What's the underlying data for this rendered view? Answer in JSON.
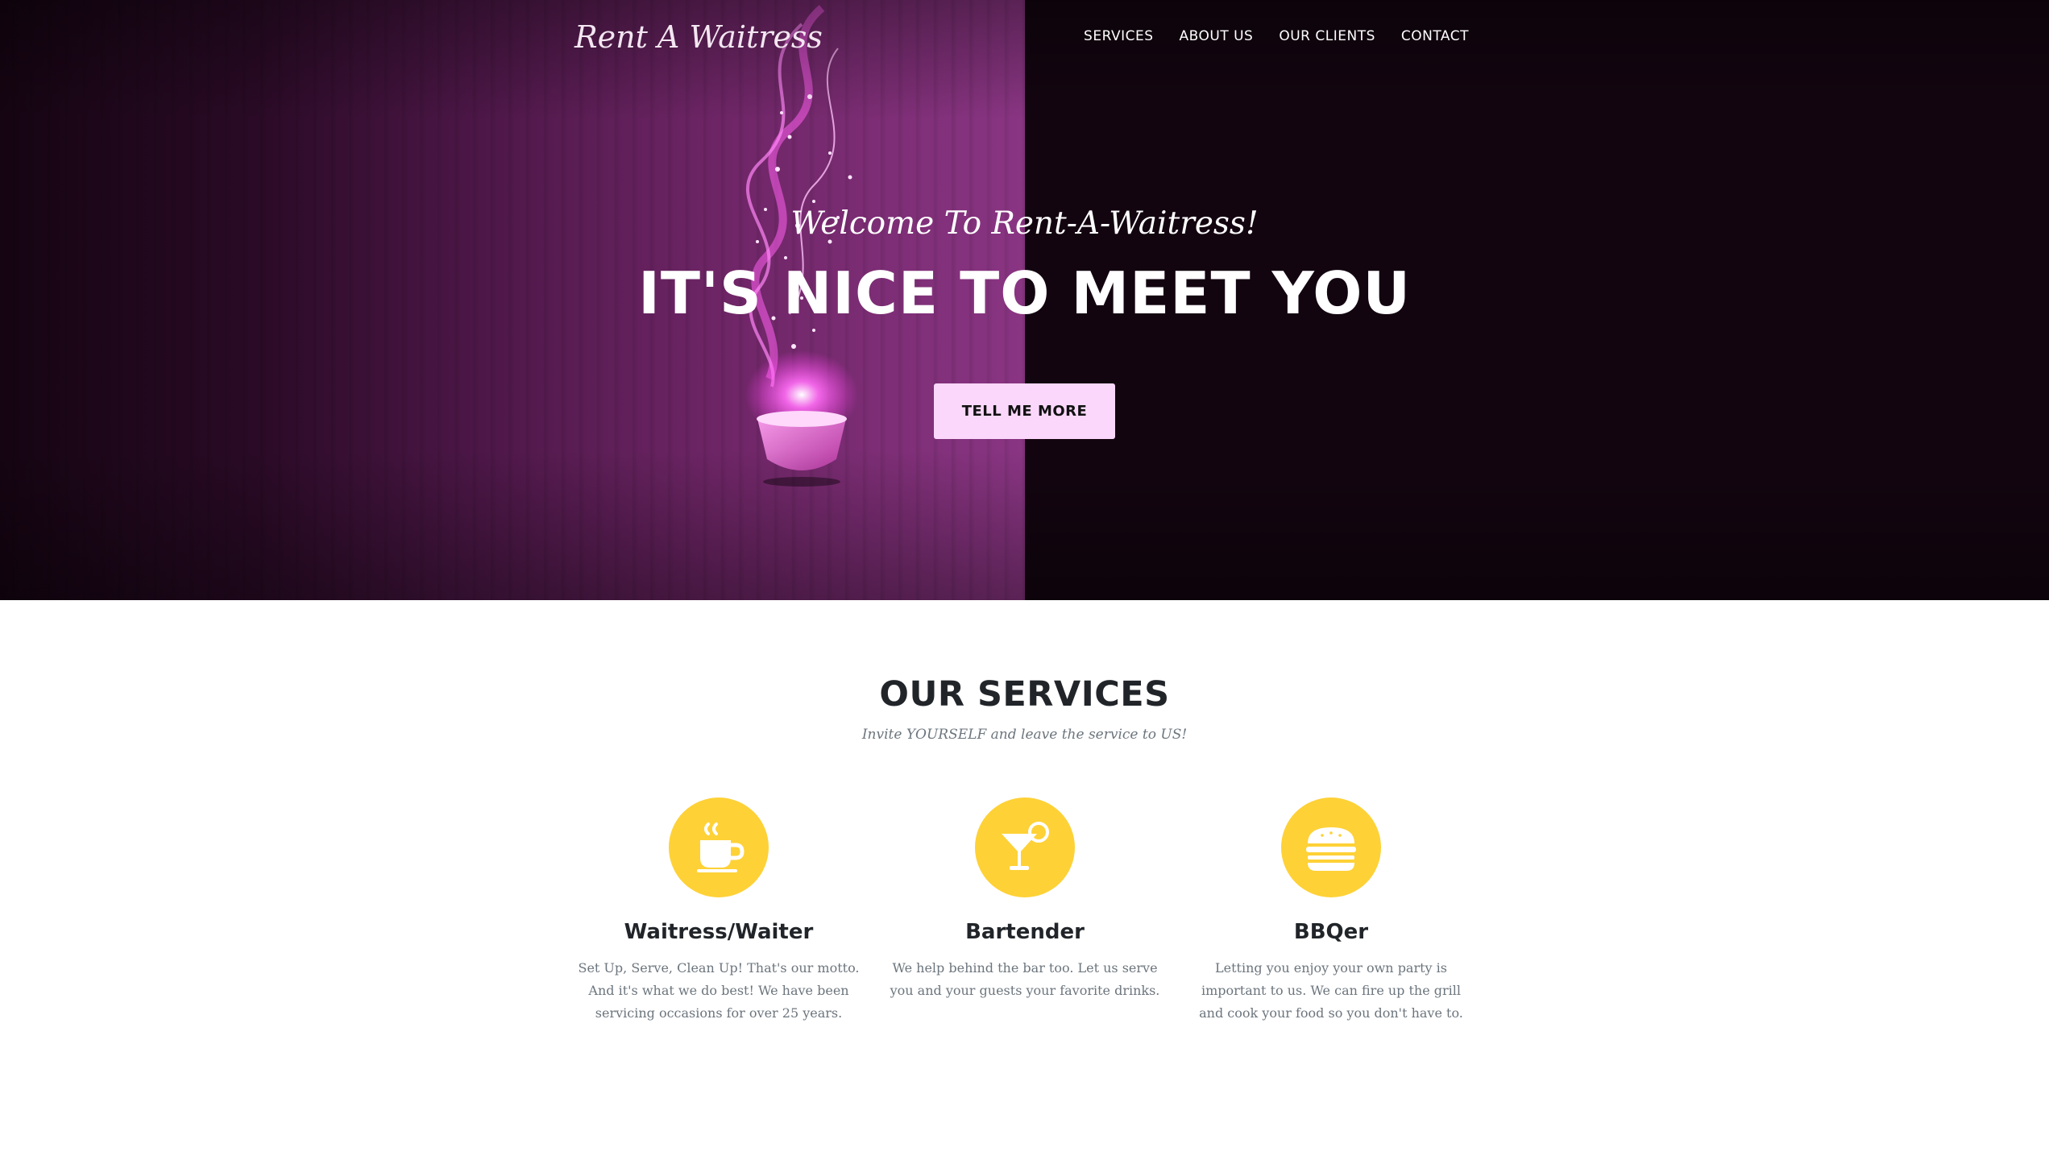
{
  "brand": {
    "logo_text": "Rent A Waitress"
  },
  "nav": {
    "items": [
      {
        "label": "SERVICES"
      },
      {
        "label": "ABOUT US"
      },
      {
        "label": "OUR CLIENTS"
      },
      {
        "label": "CONTACT"
      }
    ]
  },
  "hero": {
    "subheading": "Welcome To Rent-A-Waitress!",
    "heading": "IT'S NICE TO MEET YOU",
    "cta_label": "TELL ME MORE"
  },
  "services": {
    "title": "OUR SERVICES",
    "subtitle": "Invite YOURSELF and leave the service to US!",
    "items": [
      {
        "icon": "coffee-cup-icon",
        "name": "Waitress/Waiter",
        "description": "Set Up, Serve, Clean Up! That's our motto. And it's what we do best! We have been servicing occasions for over 25 years."
      },
      {
        "icon": "cocktail-icon",
        "name": "Bartender",
        "description": "We help behind the bar too. Let us serve you and your guests your favorite drinks."
      },
      {
        "icon": "hamburger-icon",
        "name": "BBQer",
        "description": "Letting you enjoy your own party is important to us. We can fire up the grill and cook your food so you don't have to."
      }
    ]
  },
  "colors": {
    "accent_yellow": "#fed136",
    "cta_pink": "#fbd8fb",
    "hero_dark": "#130510",
    "hero_purple": "#8a3583"
  }
}
